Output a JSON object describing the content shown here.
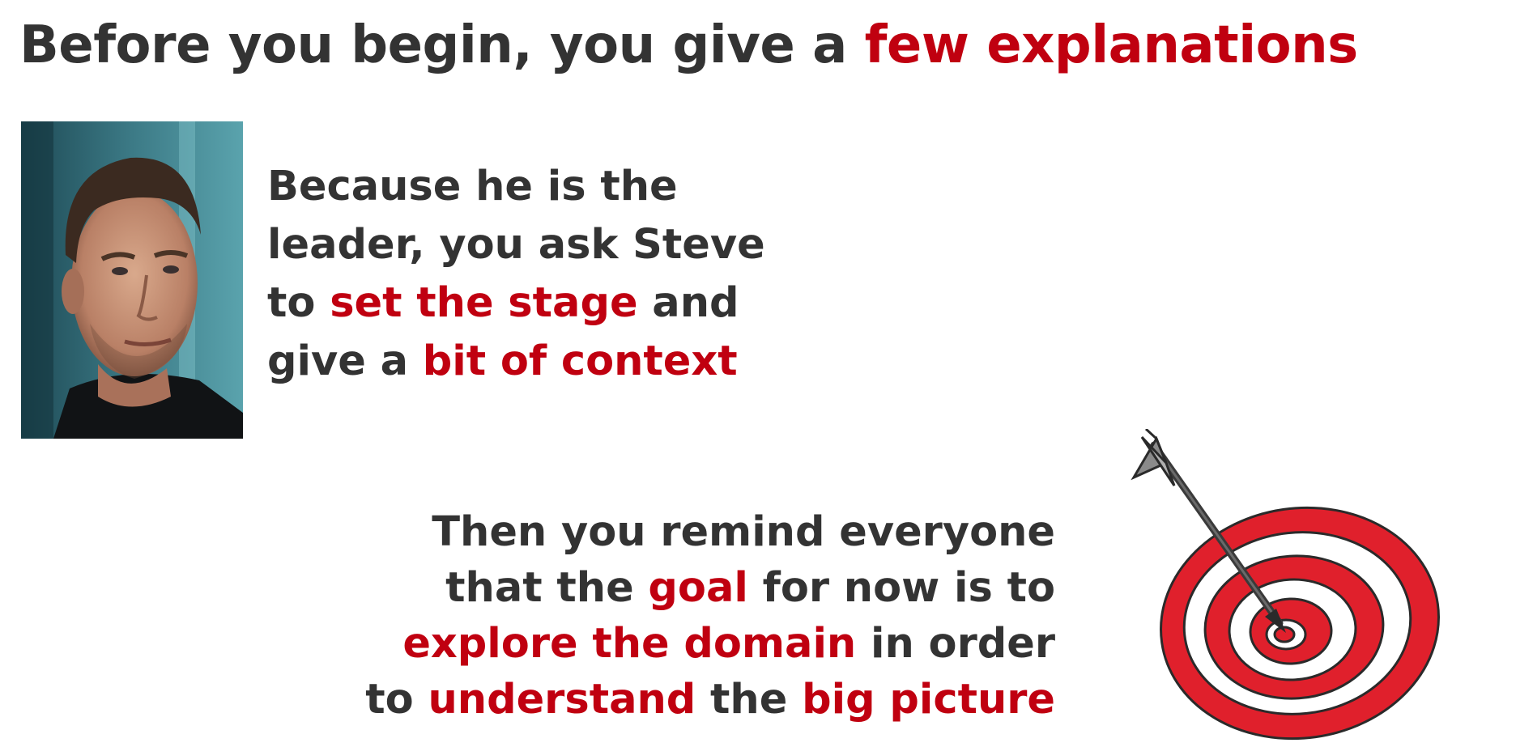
{
  "title": {
    "part1": "Before you begin, you give a ",
    "highlight": "few explanations"
  },
  "portrait": {
    "subject": "Steve"
  },
  "paragraph1": {
    "line1": "Because he is the",
    "line2": "leader, you ask Steve",
    "line3_a": "to ",
    "line3_hl": "set the stage",
    "line3_b": " and",
    "line4_a": "give a ",
    "line4_hl": "bit of context"
  },
  "paragraph2": {
    "line1": "Then you remind everyone",
    "line2_a": "that the ",
    "line2_hl": "goal",
    "line2_b": " for now is to",
    "line3_hl": "explore the domain",
    "line3_b": " in order",
    "line4_a": "to ",
    "line4_hl1": "understand",
    "line4_b": " the ",
    "line4_hl2": "big picture"
  },
  "illustration": {
    "icon": "target-with-arrow-icon"
  },
  "colors": {
    "text": "#333333",
    "highlight": "#c00010",
    "target_red": "#e0202c",
    "background": "#ffffff"
  }
}
